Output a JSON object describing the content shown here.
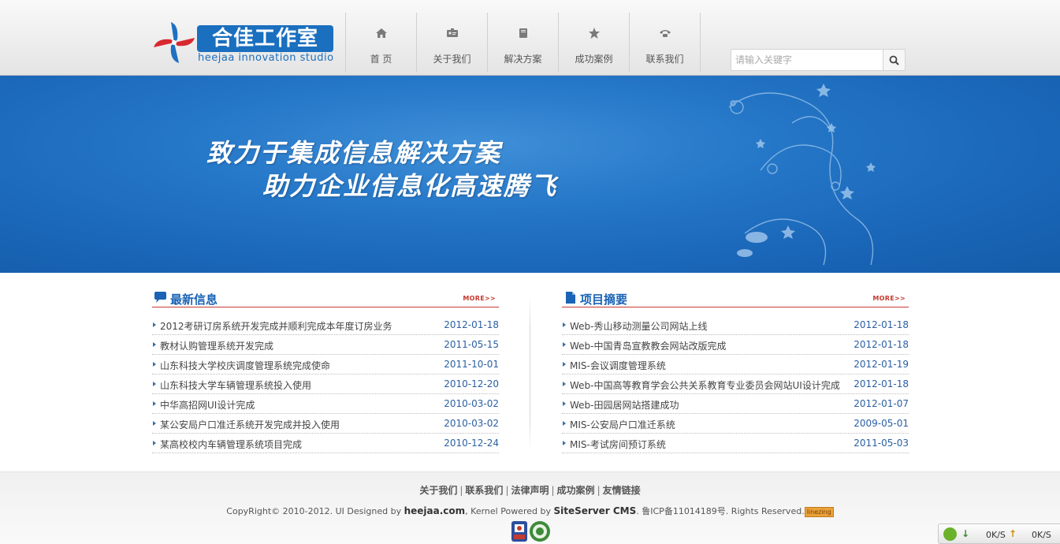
{
  "logo": {
    "cn_name": "合佳工作室",
    "en_name": "heejaa innovation studio"
  },
  "nav": [
    {
      "label": "首 页",
      "icon": "home-icon"
    },
    {
      "label": "关于我们",
      "icon": "id-card-icon"
    },
    {
      "label": "解决方案",
      "icon": "book-icon"
    },
    {
      "label": "成功案例",
      "icon": "star-icon"
    },
    {
      "label": "联系我们",
      "icon": "phone-icon"
    }
  ],
  "search": {
    "placeholder": "请输入关键字",
    "icon": "search-icon"
  },
  "banner": {
    "line1": "致力于集成信息解决方案",
    "line2": "助力企业信息化高速腾飞"
  },
  "news": {
    "title": "最新信息",
    "more": "MORE>>",
    "items": [
      {
        "title": "2012考研订房系统开发完成并顺利完成本年度订房业务",
        "date": "2012-01-18"
      },
      {
        "title": "教材认购管理系统开发完成",
        "date": "2011-05-15"
      },
      {
        "title": "山东科技大学校庆调度管理系统完成使命",
        "date": "2011-10-01"
      },
      {
        "title": "山东科技大学车辆管理系统投入使用",
        "date": "2010-12-20"
      },
      {
        "title": "中华高招网UI设计完成",
        "date": "2010-03-02"
      },
      {
        "title": "某公安局户口准迁系统开发完成并投入使用",
        "date": "2010-03-02"
      },
      {
        "title": "某高校校内车辆管理系统项目完成",
        "date": "2010-12-24"
      }
    ]
  },
  "projects": {
    "title": "项目摘要",
    "more": "MORE>>",
    "items": [
      {
        "title": "Web-秀山移动测量公司网站上线",
        "date": "2012-01-18"
      },
      {
        "title": "Web-中国青岛宣教教会网站改版完成",
        "date": "2012-01-18"
      },
      {
        "title": "MIS-会议调度管理系统",
        "date": "2012-01-19"
      },
      {
        "title": "Web-中国高等教育学会公共关系教育专业委员会网站UI设计完成",
        "date": "2012-01-18"
      },
      {
        "title": "Web-田园居网站搭建成功",
        "date": "2012-01-07"
      },
      {
        "title": "MIS-公安局户口准迁系统",
        "date": "2009-05-01"
      },
      {
        "title": "MIS-考试房间预订系统",
        "date": "2011-05-03"
      }
    ]
  },
  "footer": {
    "links": [
      "关于我们",
      "联系我们",
      "法律声明",
      "成功案例",
      "友情链接"
    ],
    "separator": "|",
    "copyright_prefix": "CopyRight© 2010-2012. UI Designed by ",
    "designer": "heejaa.com",
    "kernel_prefix": ", Kernel Powered by ",
    "cms": "SiteServer CMS",
    "icp": ". 鲁ICP备11014189号. Rights Reserved.",
    "badge": "linezing"
  },
  "speed_widget": {
    "down_value": "0K/S",
    "up_value": "0K/S"
  },
  "colors": {
    "brand_blue": "#1a6fbf",
    "accent_red": "#c63a2f",
    "banner_blue": "#2577c8",
    "date_blue": "#2a5fa3"
  }
}
